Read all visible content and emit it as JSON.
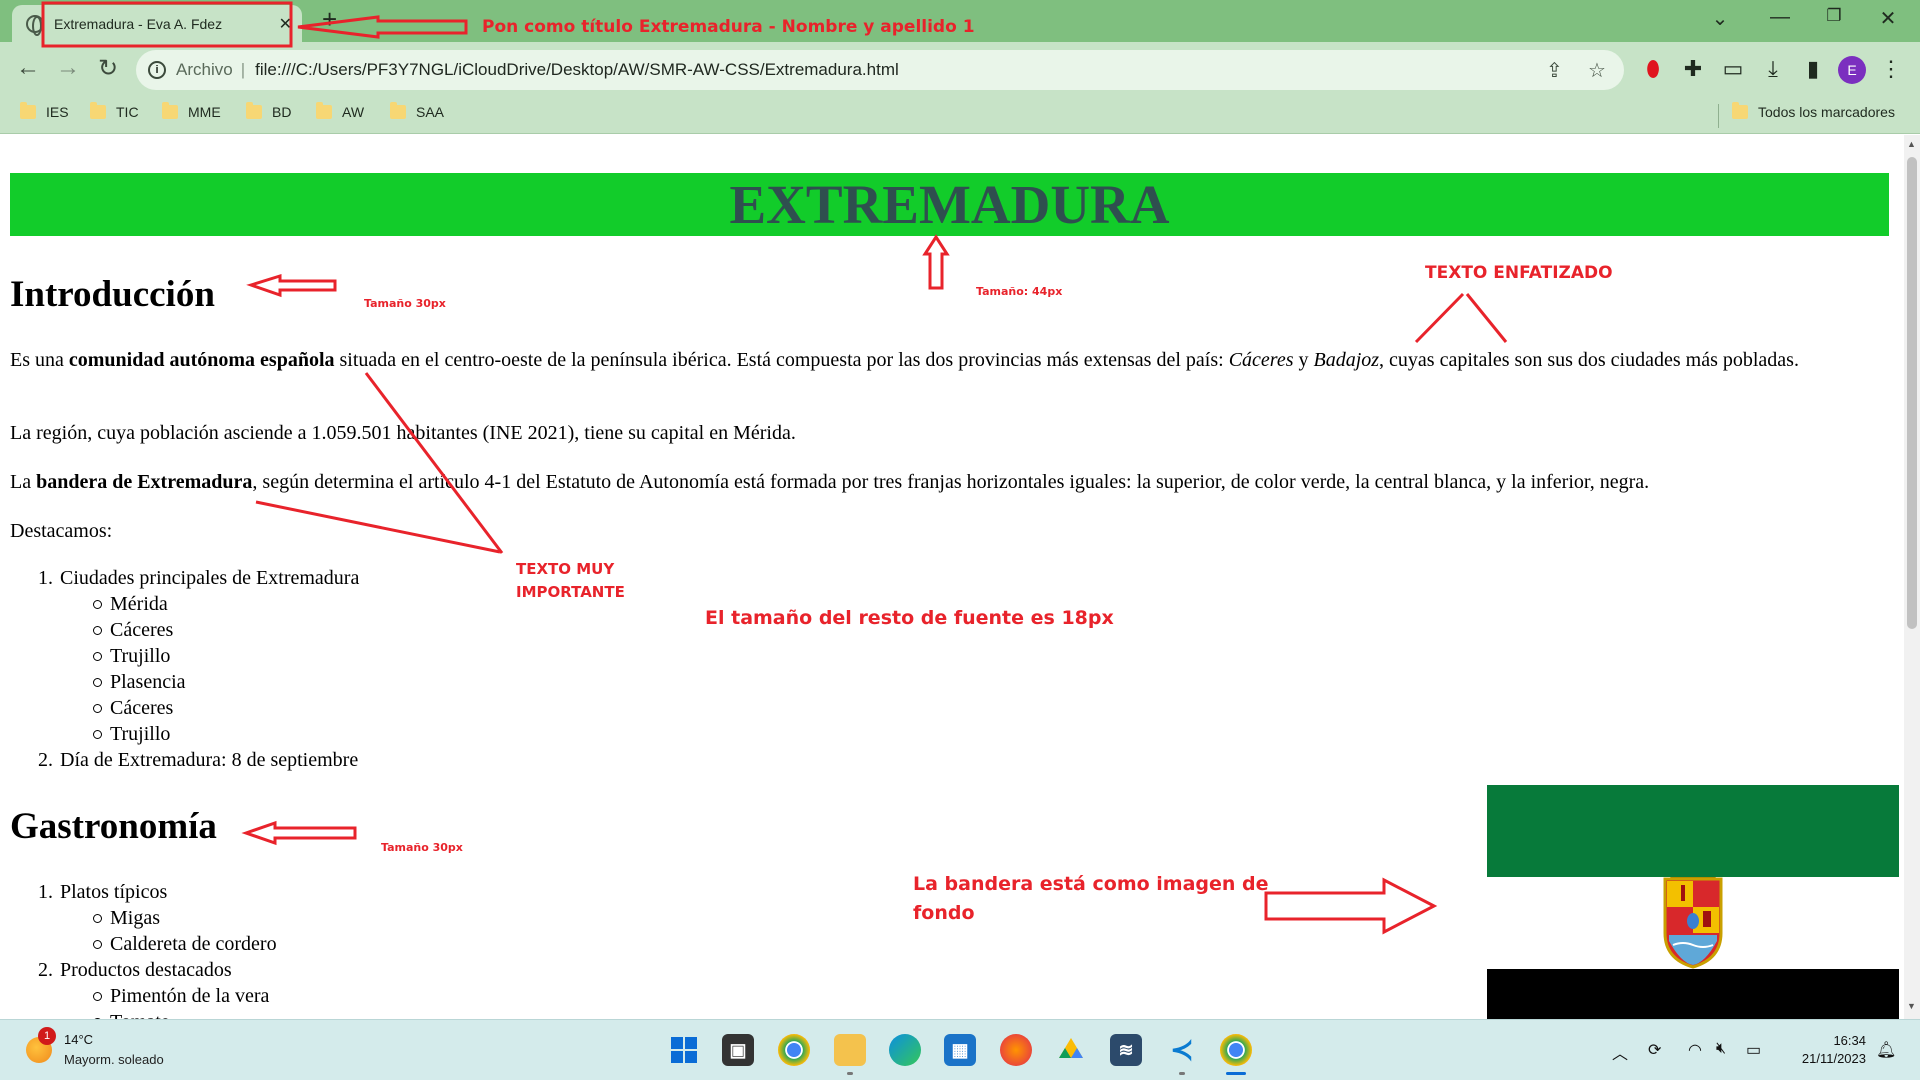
{
  "browser": {
    "tab_title": "Extremadura - Eva A. Fdez",
    "tab_close": "✕",
    "new_tab": "+",
    "url_scheme_label": "Archivo",
    "url_separator": "|",
    "url": "file:///C:/Users/PF3Y7NGL/iCloudDrive/Desktop/AW/SMR-AW-CSS/Extremadura.html",
    "avatar_letter": "E",
    "bookmarks": [
      "IES",
      "TIC",
      "MME",
      "BD",
      "AW",
      "SAA"
    ],
    "all_bookmarks": "Todos los marcadores"
  },
  "page": {
    "banner_title": "EXTREMADURA",
    "intro": {
      "heading": "Introducción",
      "p1_a": "Es una ",
      "p1_strong": "comunidad autónoma española",
      "p1_b": " situada en el centro-oeste de la península ibérica. Está compuesta por las dos provincias más extensas del país: ",
      "p1_em1": "Cáceres",
      "p1_c": " y ",
      "p1_em2": "Badajoz",
      "p1_d": ", cuyas capitales son sus dos ciudades más pobladas.",
      "p2": "La región, cuya población asciende a 1.059.501 habitantes (INE 2021), tiene su capital en Mérida.",
      "p3_a": "La ",
      "p3_strong": "bandera de Extremadura",
      "p3_b": ", según determina el artículo 4-1 del Estatuto de Autonomía está formada por tres franjas horizontales iguales: la superior, de color verde, la central blanca, y la inferior, negra.",
      "p4": "Destacamos:"
    },
    "list1": {
      "item1_num": "1.",
      "item1": "Ciudades principales de Extremadura",
      "cities": [
        "Mérida",
        "Cáceres",
        "Trujillo",
        "Plasencia",
        "Cáceres",
        "Trujillo"
      ],
      "item2_num": "2.",
      "item2": "Día de Extremadura: 8 de septiembre"
    },
    "gastro": {
      "heading": "Gastronomía",
      "item1_num": "1.",
      "item1": "Platos típicos",
      "dishes": [
        "Migas",
        "Caldereta de cordero"
      ],
      "item2_num": "2.",
      "item2": "Productos destacados",
      "products": [
        "Pimentón de la vera",
        "Tomate"
      ]
    }
  },
  "annotations": {
    "title_hint": "Pon como título Extremadura - Nombre y apellido 1",
    "h2_size_1": "Tamaño 30px",
    "h1_size": "Tamaño: 44px",
    "emphasized": "TEXTO ENFATIZADO",
    "important_1": "TEXTO MUY",
    "important_2": "IMPORTANTE",
    "font_size_rest": "El tamaño del resto de fuente es 18px",
    "h2_size_2": "Tamaño 30px",
    "flag_note_1": "La bandera está como imagen de",
    "flag_note_2": "fondo"
  },
  "taskbar": {
    "weather_badge": "1",
    "temperature": "14°C",
    "weather": "Mayorm. soleado",
    "time": "16:34",
    "date": "21/11/2023"
  },
  "colors": {
    "banner_bg": "#12cc2a",
    "banner_text": "#2f4f4f",
    "annotation": "#e8232b",
    "flag_green": "#077a3a",
    "flag_white": "#ffffff",
    "flag_black": "#000000"
  },
  "icons": [
    "globe-icon",
    "back-icon",
    "forward-icon",
    "reload-icon",
    "info-icon",
    "share-icon",
    "star-icon",
    "opera-icon",
    "extensions-icon",
    "cast-icon",
    "download-icon",
    "sidepanel-icon",
    "folder-icon",
    "windows-start-icon",
    "chrome-icon",
    "edge-icon",
    "firefox-icon",
    "vscode-icon"
  ]
}
